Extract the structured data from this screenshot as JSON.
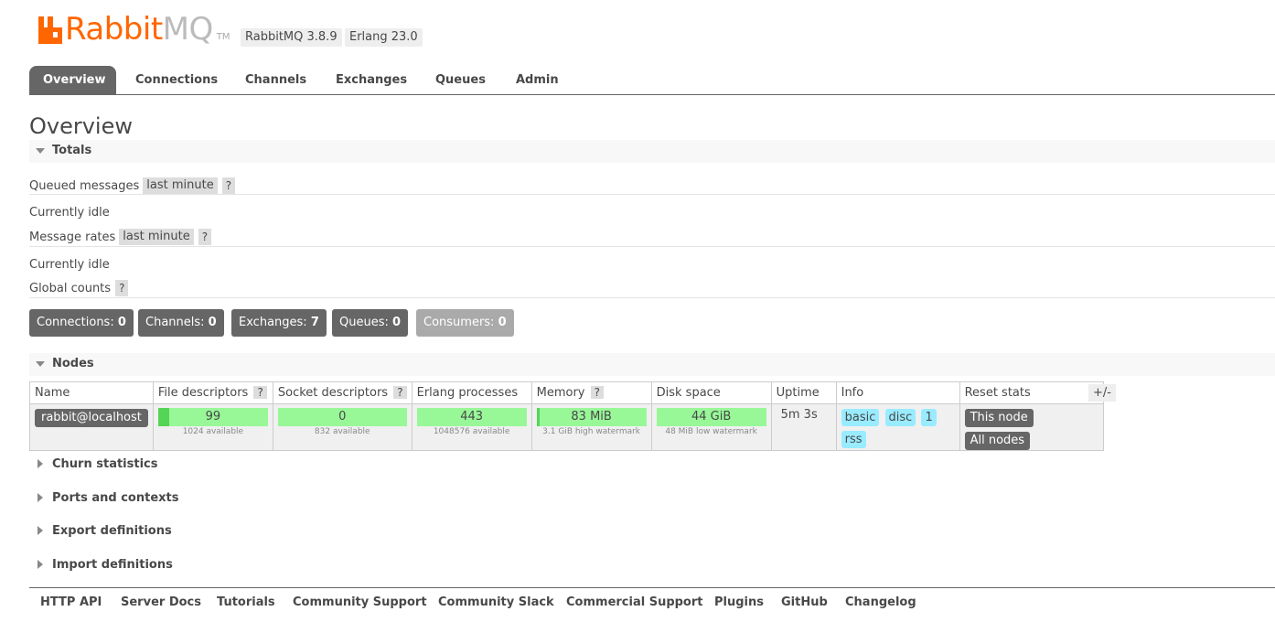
{
  "header": {
    "logo_rabbit": "Rabbit",
    "logo_mq": "MQ",
    "logo_tm": "TM",
    "rabbitmq_version": "RabbitMQ 3.8.9",
    "erlang_version": "Erlang 23.0"
  },
  "tabs": [
    "Overview",
    "Connections",
    "Channels",
    "Exchanges",
    "Queues",
    "Admin"
  ],
  "active_tab": "Overview",
  "page_title": "Overview",
  "totals": {
    "section_label": "Totals",
    "queued_messages_label": "Queued messages",
    "queued_messages_range": "last minute",
    "help": "?",
    "queued_status": "Currently idle",
    "message_rates_label": "Message rates",
    "message_rates_range": "last minute",
    "message_rates_status": "Currently idle",
    "global_counts_label": "Global counts",
    "counts": [
      {
        "label": "Connections:",
        "value": "0"
      },
      {
        "label": "Channels:",
        "value": "0"
      },
      {
        "label": "Exchanges:",
        "value": "7"
      },
      {
        "label": "Queues:",
        "value": "0"
      },
      {
        "label": "Consumers:",
        "value": "0"
      }
    ]
  },
  "nodes": {
    "section_label": "Nodes",
    "columns": [
      "Name",
      "File descriptors",
      "Socket descriptors",
      "Erlang processes",
      "Memory",
      "Disk space",
      "Uptime",
      "Info",
      "Reset stats"
    ],
    "plus_minus": "+/-",
    "row": {
      "name": "rabbit@localhost",
      "file_descriptors": "99",
      "file_descriptors_sub": "1024 available",
      "file_descriptors_used": 0.097,
      "socket_descriptors": "0",
      "socket_descriptors_sub": "832 available",
      "erlang_processes": "443",
      "erlang_processes_sub": "1048576 available",
      "memory": "83 MiB",
      "memory_sub": "3.1 GiB high watermark",
      "memory_used": 0.026,
      "disk_space": "44 GiB",
      "disk_space_sub": "48 MiB low watermark",
      "uptime": "5m 3s",
      "info_tags": [
        "basic",
        "disc",
        "1",
        "rss"
      ],
      "reset_this_node": "This node",
      "reset_all_nodes": "All nodes"
    }
  },
  "collapsed_sections": [
    "Churn statistics",
    "Ports and contexts",
    "Export definitions",
    "Import definitions"
  ],
  "footer_links": [
    "HTTP API",
    "Server Docs",
    "Tutorials",
    "Community Support",
    "Community Slack",
    "Commercial Support",
    "Plugins",
    "GitHub",
    "Changelog"
  ],
  "colors": {
    "brand_orange": "#ff6600",
    "tab_active": "#666666",
    "bar_green": "#98f898",
    "bar_green_fill": "#55d555",
    "info_tag_blue": "#99ebff"
  }
}
